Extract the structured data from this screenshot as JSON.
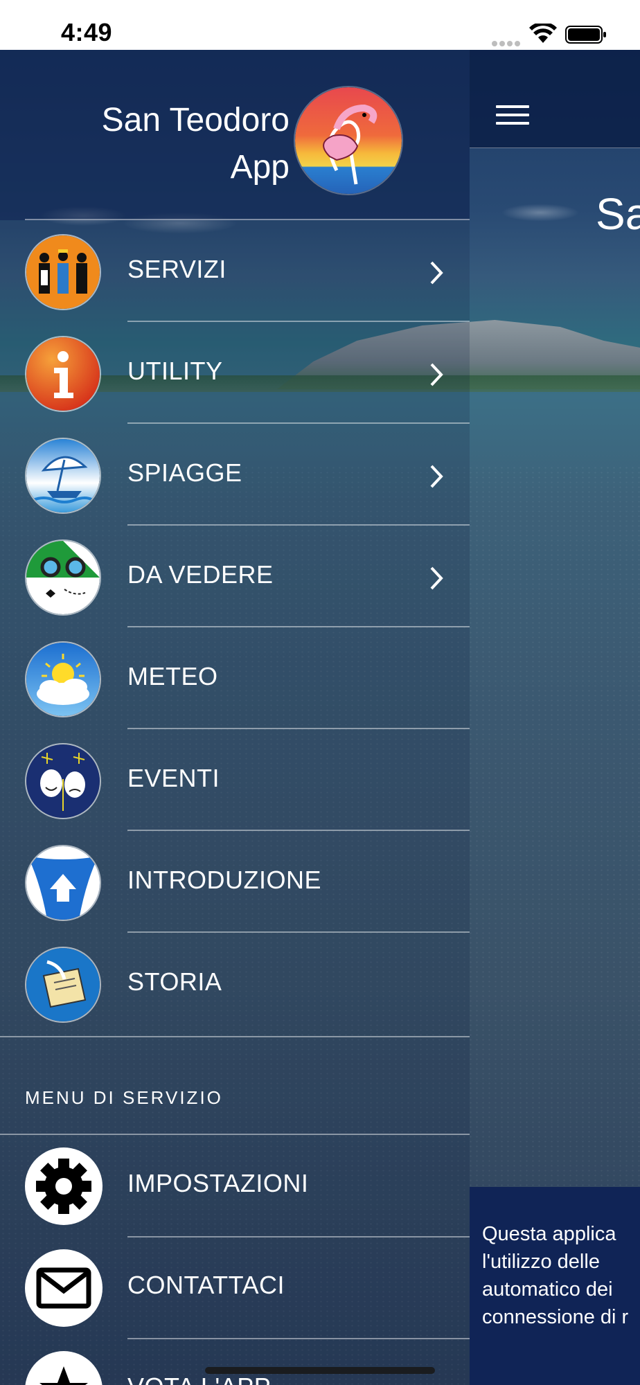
{
  "status_bar": {
    "time": "4:49"
  },
  "drawer": {
    "app_title_line1": "San Teodoro",
    "app_title_line2": "App",
    "menu": [
      {
        "label": "SERVIZI",
        "icon": "workers-icon",
        "has_submenu": true
      },
      {
        "label": "UTILITY",
        "icon": "info-icon",
        "has_submenu": true
      },
      {
        "label": "SPIAGGE",
        "icon": "beach-umbrella-icon",
        "has_submenu": true
      },
      {
        "label": "DA VEDERE",
        "icon": "binoculars-map-icon",
        "has_submenu": true
      },
      {
        "label": "METEO",
        "icon": "weather-sun-cloud-icon",
        "has_submenu": false
      },
      {
        "label": "EVENTI",
        "icon": "theater-masks-icon",
        "has_submenu": false
      },
      {
        "label": "INTRODUZIONE",
        "icon": "curtain-stage-icon",
        "has_submenu": false
      },
      {
        "label": "STORIA",
        "icon": "scroll-quill-icon",
        "has_submenu": false
      }
    ],
    "service_section_title": "MENU DI SERVIZIO",
    "service_menu": [
      {
        "label": "IMPOSTAZIONI",
        "icon": "gear-icon"
      },
      {
        "label": "CONTATTACI",
        "icon": "mail-icon"
      },
      {
        "label": "VOTA L'APP",
        "icon": "star-icon"
      }
    ]
  },
  "main": {
    "title_partial": "Sa",
    "footer_text_lines": [
      "Questa applica",
      "l'utilizzo  delle",
      "automatico  dei",
      "connessione di r"
    ]
  },
  "colors": {
    "header_bg": "#0e2250",
    "footer_bg": "#102456",
    "text": "#ffffff"
  }
}
